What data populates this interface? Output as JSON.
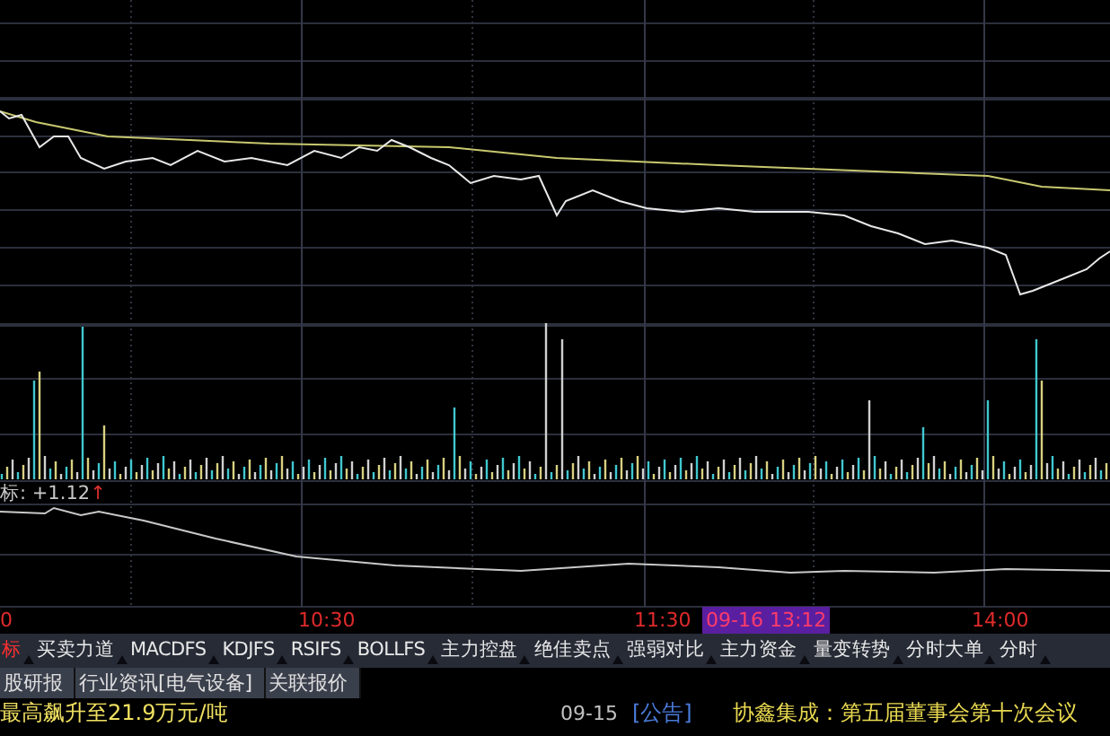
{
  "indicator": {
    "label": "标: +1.12",
    "arrow": "↑"
  },
  "time_axis": {
    "labels": [
      "0",
      "10:30",
      "11:30",
      "14:00"
    ],
    "cursor": "09-16 13:12"
  },
  "indicator_tabs": [
    {
      "label": "标",
      "selected": true
    },
    {
      "label": "买卖力道",
      "selected": false
    },
    {
      "label": "MACDFS",
      "selected": false
    },
    {
      "label": "KDJFS",
      "selected": false
    },
    {
      "label": "RSIFS",
      "selected": false
    },
    {
      "label": "BOLLFS",
      "selected": false
    },
    {
      "label": "主力控盘",
      "selected": false
    },
    {
      "label": "绝佳卖点",
      "selected": false
    },
    {
      "label": "强弱对比",
      "selected": false
    },
    {
      "label": "主力资金",
      "selected": false
    },
    {
      "label": "量变转势",
      "selected": false
    },
    {
      "label": "分时大单",
      "selected": false
    },
    {
      "label": "分时",
      "selected": false
    }
  ],
  "info_tabs": [
    "股研报",
    "行业资讯[电气设备]",
    "关联报价"
  ],
  "news": {
    "headline": "最高飙升至21.9万元/吨",
    "items": [
      {
        "date": "09-15",
        "type": "[公告]",
        "title": "协鑫集成：第五届董事会第十次会议"
      }
    ]
  }
}
